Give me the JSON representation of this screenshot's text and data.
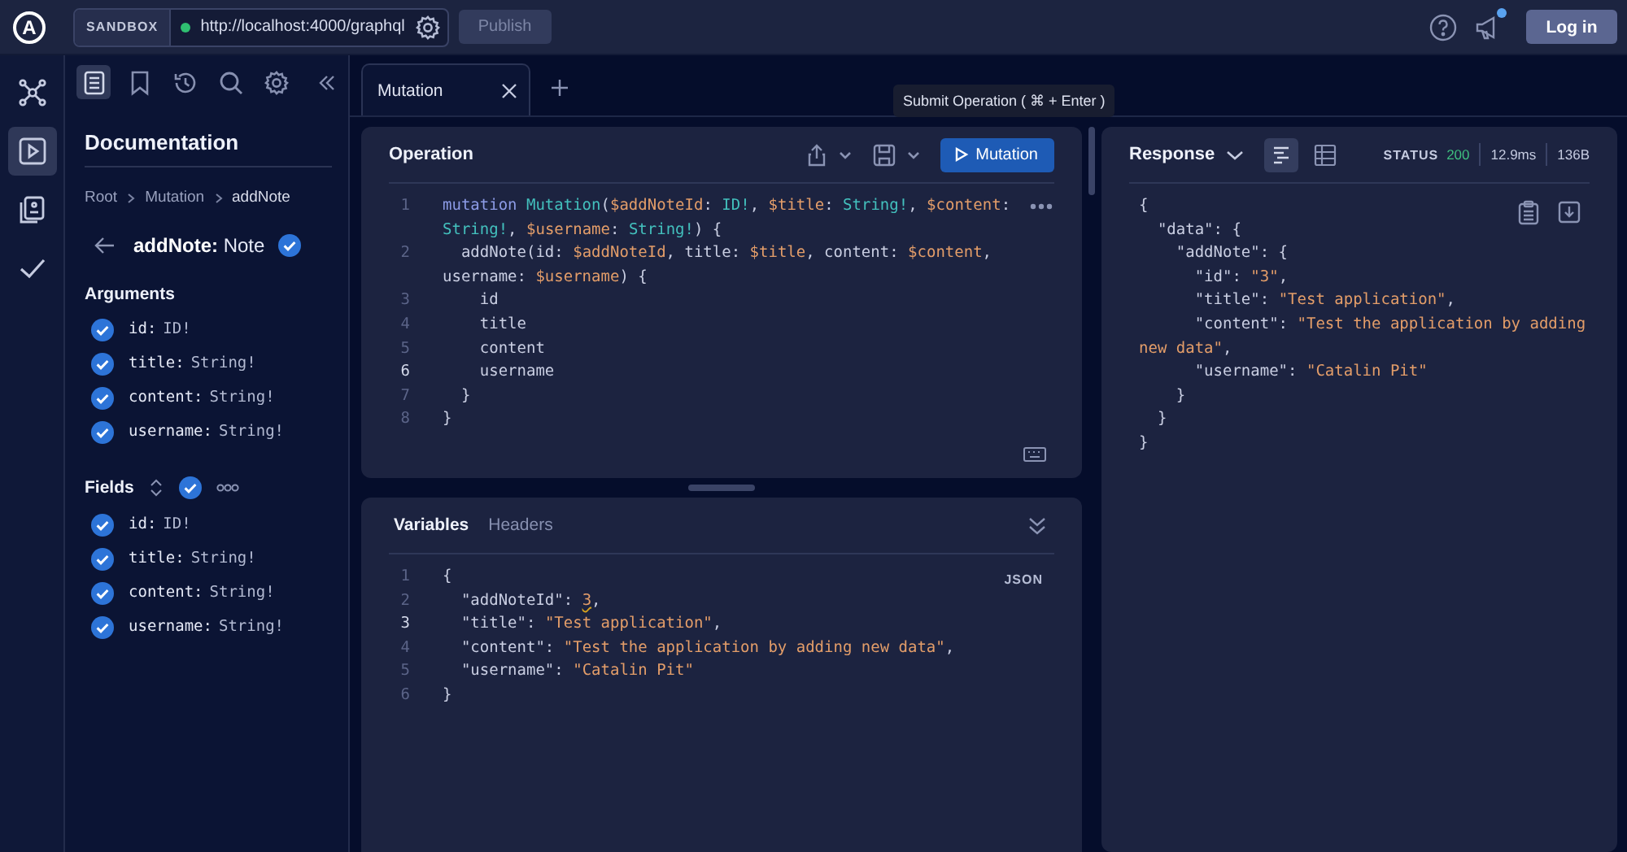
{
  "top_bar": {
    "logo": "A",
    "sandbox_label": "SANDBOX",
    "endpoint": {
      "url": "http://localhost:4000/graphql",
      "connected": true
    },
    "publish_button": {
      "label": "Publish",
      "disabled": true
    },
    "notifications_unread": true,
    "login_button": "Log in"
  },
  "rail": [
    {
      "selected": false
    },
    {
      "selected": true
    },
    {
      "selected": false
    },
    {
      "selected": false
    }
  ],
  "sidebar": {
    "toolbar": [
      {
        "selected": true
      },
      {
        "selected": false
      },
      {
        "selected": false
      },
      {
        "selected": false
      },
      {
        "selected": false
      }
    ],
    "title": "Documentation",
    "breadcrumb": [
      "Root",
      "Mutation",
      "addNote"
    ],
    "field": {
      "label": "**addNote:** Note",
      "checked": true
    },
    "arguments": {
      "heading": "Arguments",
      "items": [
        {
          "name": "id:",
          "type": "ID!",
          "checked": true
        },
        {
          "name": "title:",
          "type": "String!",
          "checked": true
        },
        {
          "name": "content:",
          "type": "String!",
          "checked": true
        },
        {
          "name": "username:",
          "type": "String!",
          "checked": true
        }
      ]
    },
    "fields": {
      "heading": "Fields",
      "checked": true,
      "items": [
        {
          "name": "id:",
          "type": "ID!",
          "checked": true
        },
        {
          "name": "title:",
          "type": "String!",
          "checked": true
        },
        {
          "name": "content:",
          "type": "String!",
          "checked": true
        },
        {
          "name": "username:",
          "type": "String!",
          "checked": true
        }
      ]
    }
  },
  "tabs": [
    {
      "label": "Mutation",
      "selected": true
    }
  ],
  "tooltip": "Submit Operation ( ⌘ + Enter )",
  "operation": {
    "title": "Operation",
    "run_button": "Mutation",
    "lines": [
      {
        "number": "1",
        "current": false,
        "tokens": [
          {
            "text": "mutation ",
            "kind": "keyword"
          },
          {
            "text": "Mutation",
            "kind": "def"
          },
          {
            "text": "(",
            "kind": "plain"
          },
          {
            "text": "$addNoteId",
            "kind": "variable"
          },
          {
            "text": ": ",
            "kind": "plain"
          },
          {
            "text": "ID!",
            "kind": "type"
          },
          {
            "text": ", ",
            "kind": "plain"
          },
          {
            "text": "$title",
            "kind": "variable"
          },
          {
            "text": ": ",
            "kind": "plain"
          },
          {
            "text": "String!",
            "kind": "type"
          },
          {
            "text": ", ",
            "kind": "plain"
          },
          {
            "text": "$content",
            "kind": "variable"
          },
          {
            "text": ": ",
            "kind": "plain"
          },
          {
            "text": "String!",
            "kind": "type"
          },
          {
            "text": ", ",
            "kind": "plain"
          },
          {
            "text": "$username",
            "kind": "variable"
          },
          {
            "text": ": ",
            "kind": "plain"
          },
          {
            "text": "String!",
            "kind": "type"
          },
          {
            "text": ") {",
            "kind": "plain"
          }
        ]
      },
      {
        "number": "2",
        "current": false,
        "tokens": [
          {
            "text": "  addNote(id: ",
            "kind": "plain"
          },
          {
            "text": "$addNoteId",
            "kind": "variable"
          },
          {
            "text": ", title: ",
            "kind": "plain"
          },
          {
            "text": "$title",
            "kind": "variable"
          },
          {
            "text": ", content: ",
            "kind": "plain"
          },
          {
            "text": "$content",
            "kind": "variable"
          },
          {
            "text": ", username: ",
            "kind": "plain"
          },
          {
            "text": "$username",
            "kind": "variable"
          },
          {
            "text": ") {",
            "kind": "plain"
          }
        ]
      },
      {
        "number": "3",
        "current": false,
        "tokens": [
          {
            "text": "    id",
            "kind": "plain"
          }
        ]
      },
      {
        "number": "4",
        "current": false,
        "tokens": [
          {
            "text": "    title",
            "kind": "plain"
          }
        ]
      },
      {
        "number": "5",
        "current": false,
        "tokens": [
          {
            "text": "    content",
            "kind": "plain"
          }
        ]
      },
      {
        "number": "6",
        "current": true,
        "tokens": [
          {
            "text": "    username",
            "kind": "plain"
          }
        ]
      },
      {
        "number": "7",
        "current": false,
        "tokens": [
          {
            "text": "  }",
            "kind": "plain"
          }
        ]
      },
      {
        "number": "8",
        "current": false,
        "tokens": [
          {
            "text": "}",
            "kind": "plain"
          }
        ]
      }
    ]
  },
  "variables": {
    "tabs": [
      {
        "label": "Variables",
        "selected": true
      },
      {
        "label": "Headers",
        "selected": false
      }
    ],
    "format": "JSON",
    "lines": [
      {
        "number": "1",
        "current": false,
        "tokens": [
          {
            "text": "{",
            "kind": "plain"
          }
        ]
      },
      {
        "number": "2",
        "current": false,
        "tokens": [
          {
            "text": "  \"addNoteId\": ",
            "kind": "plain"
          },
          {
            "text": "3",
            "kind": "warning"
          },
          {
            "text": ",",
            "kind": "plain"
          }
        ]
      },
      {
        "number": "3",
        "current": true,
        "tokens": [
          {
            "text": "  \"title\": ",
            "kind": "plain"
          },
          {
            "text": "\"Test application\"",
            "kind": "string"
          },
          {
            "text": ",",
            "kind": "plain"
          }
        ]
      },
      {
        "number": "4",
        "current": false,
        "tokens": [
          {
            "text": "  \"content\": ",
            "kind": "plain"
          },
          {
            "text": "\"Test the application by adding new data\"",
            "kind": "string"
          },
          {
            "text": ",",
            "kind": "plain"
          }
        ]
      },
      {
        "number": "5",
        "current": false,
        "tokens": [
          {
            "text": "  \"username\": ",
            "kind": "plain"
          },
          {
            "text": "\"Catalin Pit\"",
            "kind": "string"
          }
        ]
      },
      {
        "number": "6",
        "current": false,
        "tokens": [
          {
            "text": "}",
            "kind": "plain"
          }
        ]
      }
    ]
  },
  "response": {
    "title": "Response",
    "views": [
      {
        "selected": true
      },
      {
        "selected": false
      }
    ],
    "status_label": "STATUS",
    "status_code": "200",
    "time": "12.9ms",
    "size": "136B",
    "lines": [
      {
        "tokens": [
          {
            "text": "{",
            "kind": "plain"
          }
        ]
      },
      {
        "tokens": [
          {
            "text": "  \"data\": {",
            "kind": "plain"
          }
        ]
      },
      {
        "tokens": [
          {
            "text": "    \"addNote\": {",
            "kind": "plain"
          }
        ]
      },
      {
        "tokens": [
          {
            "text": "      \"id\": ",
            "kind": "plain"
          },
          {
            "text": "\"3\"",
            "kind": "string"
          },
          {
            "text": ",",
            "kind": "plain"
          }
        ]
      },
      {
        "tokens": [
          {
            "text": "      \"title\": ",
            "kind": "plain"
          },
          {
            "text": "\"Test application\"",
            "kind": "string"
          },
          {
            "text": ",",
            "kind": "plain"
          }
        ]
      },
      {
        "tokens": [
          {
            "text": "      \"content\": ",
            "kind": "plain"
          },
          {
            "text": "\"Test the application by adding new data\"",
            "kind": "string"
          },
          {
            "text": ",",
            "kind": "plain"
          }
        ]
      },
      {
        "tokens": [
          {
            "text": "      \"username\": ",
            "kind": "plain"
          },
          {
            "text": "\"Catalin Pit\"",
            "kind": "string"
          }
        ]
      },
      {
        "tokens": [
          {
            "text": "    }",
            "kind": "plain"
          }
        ]
      },
      {
        "tokens": [
          {
            "text": "  }",
            "kind": "plain"
          }
        ]
      },
      {
        "tokens": [
          {
            "text": "}",
            "kind": "plain"
          }
        ]
      }
    ]
  }
}
